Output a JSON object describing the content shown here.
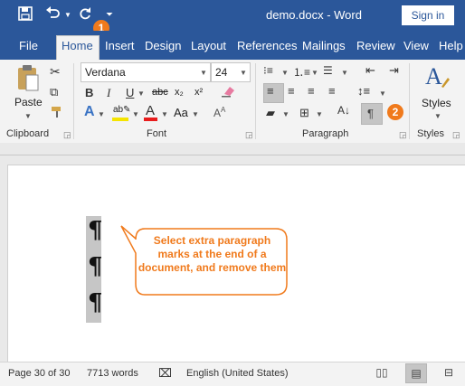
{
  "app": {
    "doc_title": "demo.docx - Word",
    "sign_in": "Sign in"
  },
  "quick_access": {
    "save_icon": "save-icon",
    "undo_icon": "undo-icon",
    "redo_icon": "redo-icon",
    "customize_icon": "customize-icon"
  },
  "badges": {
    "one": "1",
    "two": "2"
  },
  "tabs": [
    "File",
    "Home",
    "Insert",
    "Design",
    "Layout",
    "References",
    "Mailings",
    "Review",
    "View",
    "Help"
  ],
  "ribbon": {
    "clipboard": {
      "paste_label": "Paste",
      "group_label": "Clipboard"
    },
    "font": {
      "font_name": "Verdana",
      "font_size": "24",
      "group_label": "Font",
      "bold": "B",
      "italic": "I",
      "underline": "U",
      "strike": "abc",
      "sub": "x₂",
      "sup": "x²",
      "change_case": "Aa"
    },
    "paragraph": {
      "group_label": "Paragraph",
      "show_marks": "¶"
    },
    "styles": {
      "label": "Styles",
      "group_label": "Styles"
    }
  },
  "document": {
    "marks": [
      "¶",
      "¶",
      "¶"
    ]
  },
  "callout": {
    "text": "Select extra paragraph marks at the end of a document, and remove them"
  },
  "status": {
    "page": "Page 30 of 30",
    "words": "7713 words",
    "language": "English (United States)"
  },
  "colors": {
    "title_bar": "#2b579a",
    "accent_orange": "#f07a1c",
    "highlight_yellow": "#f5e400",
    "font_red": "#e81c1c"
  }
}
